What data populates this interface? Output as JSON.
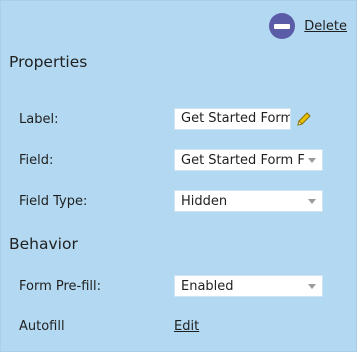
{
  "header": {
    "delete_label": "Delete",
    "delete_icon": "minus-circle-icon"
  },
  "properties": {
    "title": "Properties",
    "label_field": {
      "label": "Label:",
      "value": "Get Started Form",
      "edit_icon": "pencil-icon"
    },
    "field_field": {
      "label": "Field:",
      "value": "Get Started Form F"
    },
    "field_type": {
      "label": "Field Type:",
      "value": "Hidden"
    }
  },
  "behavior": {
    "title": "Behavior",
    "form_prefill": {
      "label": "Form Pre-fill:",
      "value": "Enabled"
    },
    "autofill": {
      "label": "Autofill",
      "link_label": "Edit"
    }
  },
  "colors": {
    "background": "#b3d9f2",
    "delete_icon": "#5b5ca8",
    "pencil": "#d4b000"
  }
}
